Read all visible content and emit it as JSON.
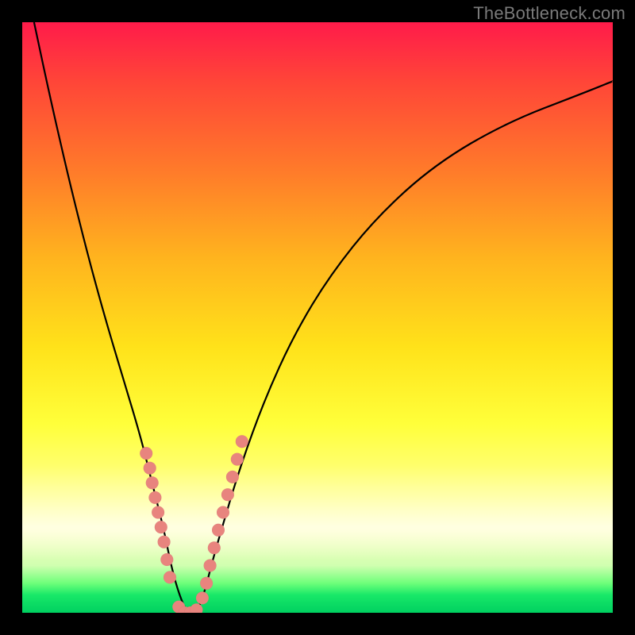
{
  "watermark": "TheBottleneck.com",
  "colors": {
    "gradient_top": "#ff1b4a",
    "gradient_bottom": "#00d060",
    "dot": "#e8847e",
    "curve": "#000000",
    "frame_bg": "#000000"
  },
  "chart_data": {
    "type": "line",
    "title": "",
    "xlabel": "",
    "ylabel": "",
    "x_range": [
      0,
      100
    ],
    "y_range": [
      0,
      100
    ],
    "series": [
      {
        "name": "response-curve",
        "x": [
          2,
          5,
          8,
          11,
          14,
          17,
          20,
          22,
          24,
          25,
          26,
          27,
          28,
          29,
          30,
          31,
          32,
          34,
          37,
          41,
          46,
          52,
          60,
          70,
          82,
          95,
          100
        ],
        "y": [
          100,
          86,
          73,
          61,
          50,
          40,
          30,
          22,
          14,
          9,
          5,
          2,
          0,
          0,
          1,
          4,
          8,
          15,
          25,
          36,
          47,
          57,
          67,
          76,
          83,
          88,
          90
        ]
      }
    ],
    "markers": {
      "name": "highlight-dots",
      "points": [
        {
          "x": 21.0,
          "y": 27.0
        },
        {
          "x": 21.6,
          "y": 24.5
        },
        {
          "x": 22.0,
          "y": 22.0
        },
        {
          "x": 22.5,
          "y": 19.5
        },
        {
          "x": 23.0,
          "y": 17.0
        },
        {
          "x": 23.5,
          "y": 14.5
        },
        {
          "x": 24.0,
          "y": 12.0
        },
        {
          "x": 24.5,
          "y": 9.0
        },
        {
          "x": 25.0,
          "y": 6.0
        },
        {
          "x": 26.5,
          "y": 1.0
        },
        {
          "x": 27.5,
          "y": 0.0
        },
        {
          "x": 28.5,
          "y": 0.0
        },
        {
          "x": 29.5,
          "y": 0.5
        },
        {
          "x": 30.5,
          "y": 2.5
        },
        {
          "x": 31.2,
          "y": 5.0
        },
        {
          "x": 31.8,
          "y": 8.0
        },
        {
          "x": 32.5,
          "y": 11.0
        },
        {
          "x": 33.2,
          "y": 14.0
        },
        {
          "x": 34.0,
          "y": 17.0
        },
        {
          "x": 34.8,
          "y": 20.0
        },
        {
          "x": 35.6,
          "y": 23.0
        },
        {
          "x": 36.4,
          "y": 26.0
        },
        {
          "x": 37.2,
          "y": 29.0
        }
      ]
    }
  }
}
